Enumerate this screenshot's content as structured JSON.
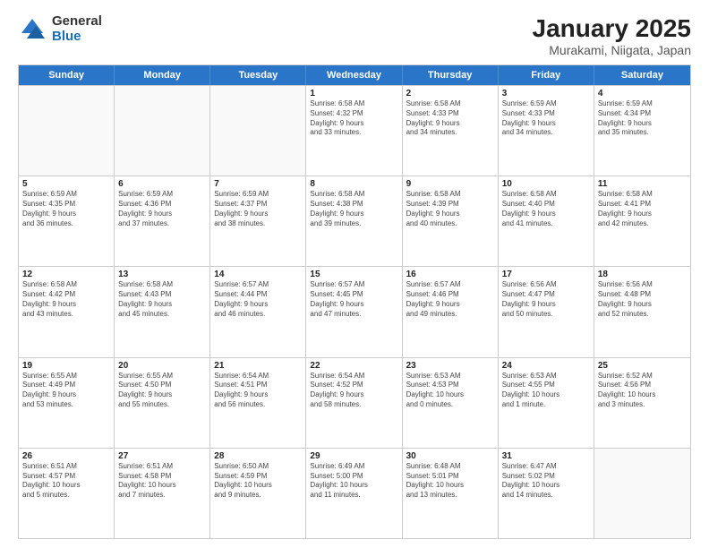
{
  "logo": {
    "general": "General",
    "blue": "Blue"
  },
  "title": "January 2025",
  "subtitle": "Murakami, Niigata, Japan",
  "weekdays": [
    "Sunday",
    "Monday",
    "Tuesday",
    "Wednesday",
    "Thursday",
    "Friday",
    "Saturday"
  ],
  "weeks": [
    [
      {
        "day": "",
        "info": ""
      },
      {
        "day": "",
        "info": ""
      },
      {
        "day": "",
        "info": ""
      },
      {
        "day": "1",
        "info": "Sunrise: 6:58 AM\nSunset: 4:32 PM\nDaylight: 9 hours\nand 33 minutes."
      },
      {
        "day": "2",
        "info": "Sunrise: 6:58 AM\nSunset: 4:33 PM\nDaylight: 9 hours\nand 34 minutes."
      },
      {
        "day": "3",
        "info": "Sunrise: 6:59 AM\nSunset: 4:33 PM\nDaylight: 9 hours\nand 34 minutes."
      },
      {
        "day": "4",
        "info": "Sunrise: 6:59 AM\nSunset: 4:34 PM\nDaylight: 9 hours\nand 35 minutes."
      }
    ],
    [
      {
        "day": "5",
        "info": "Sunrise: 6:59 AM\nSunset: 4:35 PM\nDaylight: 9 hours\nand 36 minutes."
      },
      {
        "day": "6",
        "info": "Sunrise: 6:59 AM\nSunset: 4:36 PM\nDaylight: 9 hours\nand 37 minutes."
      },
      {
        "day": "7",
        "info": "Sunrise: 6:59 AM\nSunset: 4:37 PM\nDaylight: 9 hours\nand 38 minutes."
      },
      {
        "day": "8",
        "info": "Sunrise: 6:58 AM\nSunset: 4:38 PM\nDaylight: 9 hours\nand 39 minutes."
      },
      {
        "day": "9",
        "info": "Sunrise: 6:58 AM\nSunset: 4:39 PM\nDaylight: 9 hours\nand 40 minutes."
      },
      {
        "day": "10",
        "info": "Sunrise: 6:58 AM\nSunset: 4:40 PM\nDaylight: 9 hours\nand 41 minutes."
      },
      {
        "day": "11",
        "info": "Sunrise: 6:58 AM\nSunset: 4:41 PM\nDaylight: 9 hours\nand 42 minutes."
      }
    ],
    [
      {
        "day": "12",
        "info": "Sunrise: 6:58 AM\nSunset: 4:42 PM\nDaylight: 9 hours\nand 43 minutes."
      },
      {
        "day": "13",
        "info": "Sunrise: 6:58 AM\nSunset: 4:43 PM\nDaylight: 9 hours\nand 45 minutes."
      },
      {
        "day": "14",
        "info": "Sunrise: 6:57 AM\nSunset: 4:44 PM\nDaylight: 9 hours\nand 46 minutes."
      },
      {
        "day": "15",
        "info": "Sunrise: 6:57 AM\nSunset: 4:45 PM\nDaylight: 9 hours\nand 47 minutes."
      },
      {
        "day": "16",
        "info": "Sunrise: 6:57 AM\nSunset: 4:46 PM\nDaylight: 9 hours\nand 49 minutes."
      },
      {
        "day": "17",
        "info": "Sunrise: 6:56 AM\nSunset: 4:47 PM\nDaylight: 9 hours\nand 50 minutes."
      },
      {
        "day": "18",
        "info": "Sunrise: 6:56 AM\nSunset: 4:48 PM\nDaylight: 9 hours\nand 52 minutes."
      }
    ],
    [
      {
        "day": "19",
        "info": "Sunrise: 6:55 AM\nSunset: 4:49 PM\nDaylight: 9 hours\nand 53 minutes."
      },
      {
        "day": "20",
        "info": "Sunrise: 6:55 AM\nSunset: 4:50 PM\nDaylight: 9 hours\nand 55 minutes."
      },
      {
        "day": "21",
        "info": "Sunrise: 6:54 AM\nSunset: 4:51 PM\nDaylight: 9 hours\nand 56 minutes."
      },
      {
        "day": "22",
        "info": "Sunrise: 6:54 AM\nSunset: 4:52 PM\nDaylight: 9 hours\nand 58 minutes."
      },
      {
        "day": "23",
        "info": "Sunrise: 6:53 AM\nSunset: 4:53 PM\nDaylight: 10 hours\nand 0 minutes."
      },
      {
        "day": "24",
        "info": "Sunrise: 6:53 AM\nSunset: 4:55 PM\nDaylight: 10 hours\nand 1 minute."
      },
      {
        "day": "25",
        "info": "Sunrise: 6:52 AM\nSunset: 4:56 PM\nDaylight: 10 hours\nand 3 minutes."
      }
    ],
    [
      {
        "day": "26",
        "info": "Sunrise: 6:51 AM\nSunset: 4:57 PM\nDaylight: 10 hours\nand 5 minutes."
      },
      {
        "day": "27",
        "info": "Sunrise: 6:51 AM\nSunset: 4:58 PM\nDaylight: 10 hours\nand 7 minutes."
      },
      {
        "day": "28",
        "info": "Sunrise: 6:50 AM\nSunset: 4:59 PM\nDaylight: 10 hours\nand 9 minutes."
      },
      {
        "day": "29",
        "info": "Sunrise: 6:49 AM\nSunset: 5:00 PM\nDaylight: 10 hours\nand 11 minutes."
      },
      {
        "day": "30",
        "info": "Sunrise: 6:48 AM\nSunset: 5:01 PM\nDaylight: 10 hours\nand 13 minutes."
      },
      {
        "day": "31",
        "info": "Sunrise: 6:47 AM\nSunset: 5:02 PM\nDaylight: 10 hours\nand 14 minutes."
      },
      {
        "day": "",
        "info": ""
      }
    ]
  ]
}
